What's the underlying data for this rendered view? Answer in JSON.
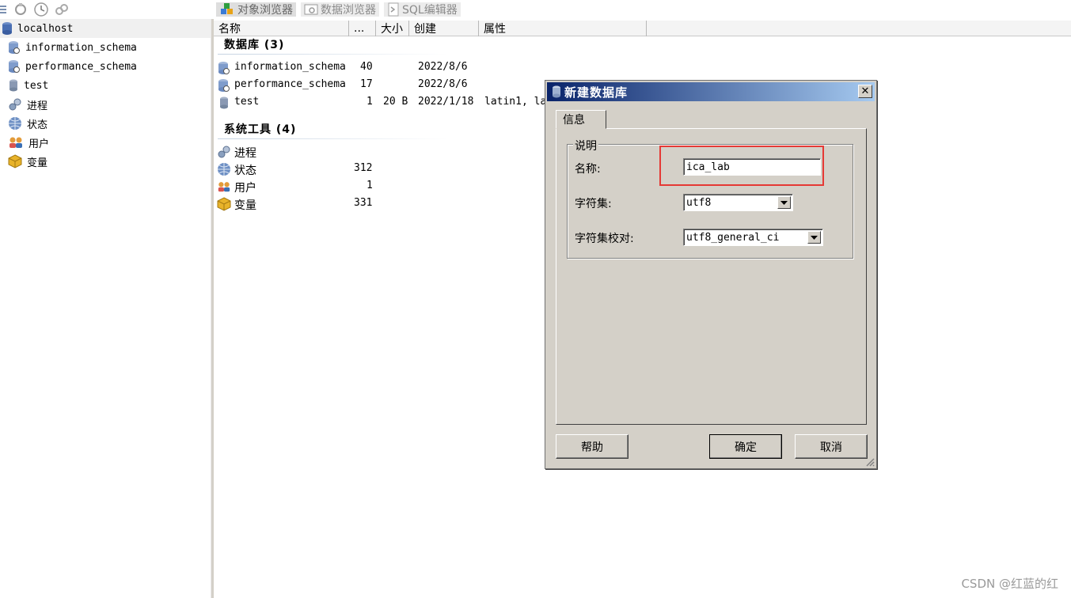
{
  "toolbar": {
    "tabs": [
      {
        "label": "对象浏览器",
        "icon": "object-browser-icon"
      },
      {
        "label": "数据浏览器",
        "icon": "data-browser-icon"
      },
      {
        "label": "SQL编辑器",
        "icon": "sql-editor-icon"
      }
    ]
  },
  "sidebar": {
    "root": "localhost",
    "items": [
      {
        "label": "information_schema",
        "icon": "schema-icon"
      },
      {
        "label": "performance_schema",
        "icon": "schema-icon"
      },
      {
        "label": "test",
        "icon": "database-icon"
      },
      {
        "label": "进程",
        "icon": "process-icon"
      },
      {
        "label": "状态",
        "icon": "status-icon"
      },
      {
        "label": "用户",
        "icon": "users-icon"
      },
      {
        "label": "变量",
        "icon": "variables-icon"
      }
    ]
  },
  "main": {
    "columns": [
      "名称",
      "...",
      "大小",
      "创建",
      "属性"
    ],
    "databases_title": "数据库 (3)",
    "databases": [
      {
        "name": "information_schema",
        "count": "40",
        "size": "",
        "created": "2022/8/6",
        "attrs": ""
      },
      {
        "name": "performance_schema",
        "count": "17",
        "size": "",
        "created": "2022/8/6",
        "attrs": ""
      },
      {
        "name": "test",
        "count": "1",
        "size": "20 B",
        "created": "2022/1/18",
        "attrs": "latin1, la"
      }
    ],
    "tools_title": "系统工具 (4)",
    "tools": [
      {
        "name": "进程",
        "count": ""
      },
      {
        "name": "状态",
        "count": "312"
      },
      {
        "name": "用户",
        "count": "1"
      },
      {
        "name": "变量",
        "count": "331"
      }
    ]
  },
  "dialog": {
    "title": "新建数据库",
    "tab": "信息",
    "group": "说明",
    "name_label": "名称:",
    "name_value": "ica_lab",
    "charset_label": "字符集:",
    "charset_value": "utf8",
    "collation_label": "字符集校对:",
    "collation_value": "utf8_general_ci",
    "help": "帮助",
    "ok": "确定",
    "cancel": "取消"
  },
  "watermark": "CSDN @红蓝的红"
}
